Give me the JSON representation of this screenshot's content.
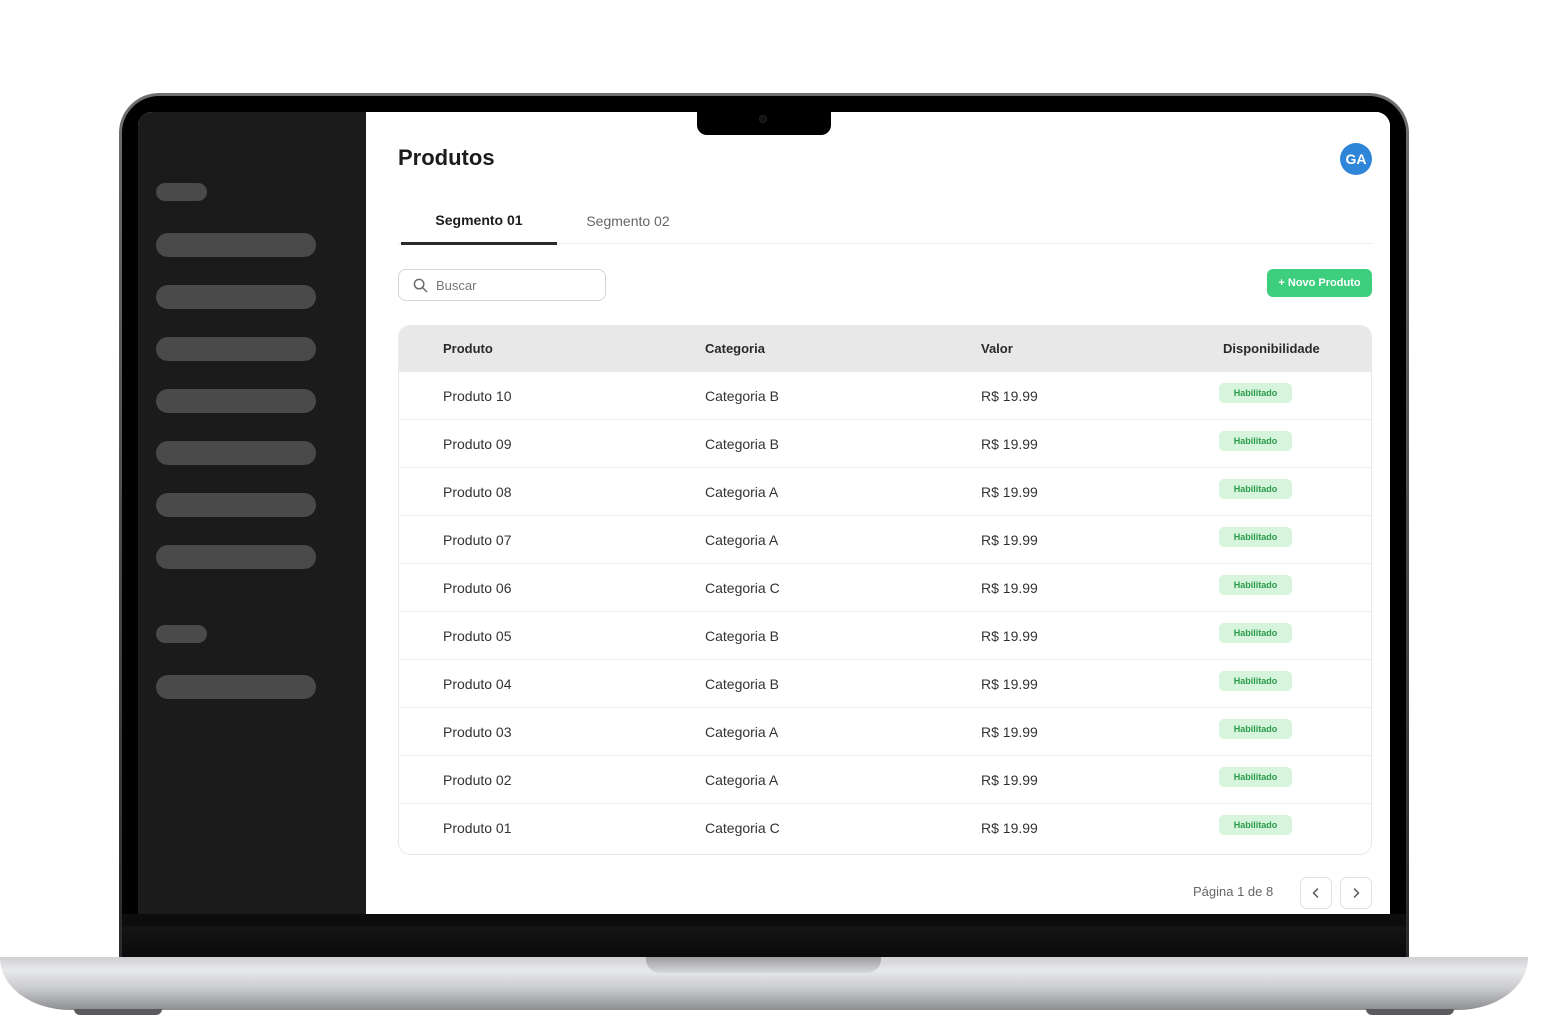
{
  "page": {
    "title": "Produtos",
    "avatar_initials": "GA"
  },
  "tabs": [
    {
      "label": "Segmento 01",
      "active": true
    },
    {
      "label": "Segmento 02",
      "active": false
    }
  ],
  "search": {
    "placeholder": "Buscar",
    "value": ""
  },
  "toolbar": {
    "new_product_label": "+ Novo Produto"
  },
  "table": {
    "columns": [
      "Produto",
      "Categoria",
      "Valor",
      "Disponibilidade"
    ],
    "rows": [
      {
        "product": "Produto 10",
        "category": "Categoria B",
        "value": "R$ 19.99",
        "status": "Habilitado"
      },
      {
        "product": "Produto 09",
        "category": "Categoria B",
        "value": "R$ 19.99",
        "status": "Habilitado"
      },
      {
        "product": "Produto 08",
        "category": "Categoria A",
        "value": "R$ 19.99",
        "status": "Habilitado"
      },
      {
        "product": "Produto 07",
        "category": "Categoria A",
        "value": "R$ 19.99",
        "status": "Habilitado"
      },
      {
        "product": "Produto 06",
        "category": "Categoria C",
        "value": "R$ 19.99",
        "status": "Habilitado"
      },
      {
        "product": "Produto 05",
        "category": "Categoria B",
        "value": "R$ 19.99",
        "status": "Habilitado"
      },
      {
        "product": "Produto 04",
        "category": "Categoria B",
        "value": "R$ 19.99",
        "status": "Habilitado"
      },
      {
        "product": "Produto 03",
        "category": "Categoria A",
        "value": "R$ 19.99",
        "status": "Habilitado"
      },
      {
        "product": "Produto 02",
        "category": "Categoria A",
        "value": "R$ 19.99",
        "status": "Habilitado"
      },
      {
        "product": "Produto 01",
        "category": "Categoria C",
        "value": "R$ 19.99",
        "status": "Habilitado"
      }
    ]
  },
  "pagination": {
    "label": "Página 1 de 8",
    "prev_icon": "chevron-left-icon",
    "next_icon": "chevron-right-icon"
  },
  "colors": {
    "sidebar": "#1b1b1b",
    "accent_green": "#3ecf7e",
    "badge_bg": "#d6f5dc",
    "badge_text": "#2a9a48",
    "avatar": "#2f86d8"
  },
  "icons": {
    "search": "search-icon"
  }
}
